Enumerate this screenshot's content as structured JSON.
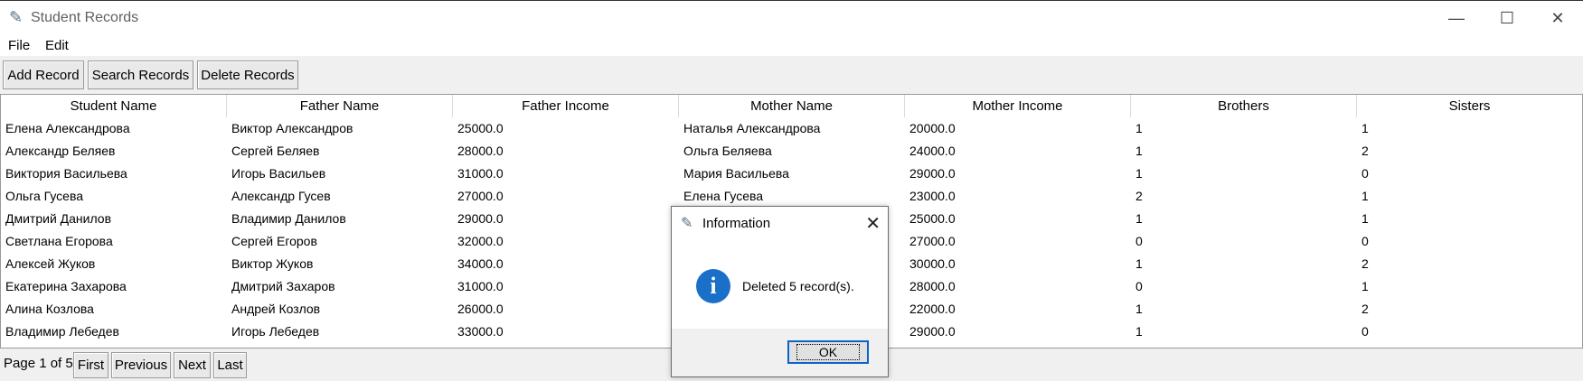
{
  "window": {
    "title": "Student Records",
    "controls": {
      "minimize": "—",
      "maximize": "☐",
      "close": "✕"
    }
  },
  "menu": [
    "File",
    "Edit"
  ],
  "toolbar": {
    "add": "Add Record",
    "search": "Search Records",
    "delete": "Delete Records"
  },
  "table": {
    "columns": [
      "Student Name",
      "Father Name",
      "Father Income",
      "Mother Name",
      "Mother Income",
      "Brothers",
      "Sisters"
    ],
    "rows": [
      [
        "Елена Александрова",
        "Виктор Александров",
        "25000.0",
        "Наталья Александрова",
        "20000.0",
        "1",
        "1"
      ],
      [
        "Александр Беляев",
        "Сергей Беляев",
        "28000.0",
        "Ольга Беляева",
        "24000.0",
        "1",
        "2"
      ],
      [
        "Виктория Васильева",
        "Игорь Васильев",
        "31000.0",
        "Мария Васильева",
        "29000.0",
        "1",
        "0"
      ],
      [
        "Ольга Гусева",
        "Александр Гусев",
        "27000.0",
        "Елена Гусева",
        "23000.0",
        "2",
        "1"
      ],
      [
        "Дмитрий Данилов",
        "Владимир Данилов",
        "29000.0",
        "",
        "25000.0",
        "1",
        "1"
      ],
      [
        "Светлана Егорова",
        "Сергей Егоров",
        "32000.0",
        "",
        "27000.0",
        "0",
        "0"
      ],
      [
        "Алексей Жуков",
        "Виктор Жуков",
        "34000.0",
        "",
        "30000.0",
        "1",
        "2"
      ],
      [
        "Екатерина Захарова",
        "Дмитрий Захаров",
        "31000.0",
        "",
        "28000.0",
        "0",
        "1"
      ],
      [
        "Алина Козлова",
        "Андрей Козлов",
        "26000.0",
        "",
        "22000.0",
        "1",
        "2"
      ],
      [
        "Владимир Лебедев",
        "Игорь Лебедев",
        "33000.0",
        "",
        "29000.0",
        "1",
        "0"
      ]
    ]
  },
  "pager": {
    "info": "Page 1 of 5",
    "first": "First",
    "previous": "Previous",
    "next": "Next",
    "last": "Last"
  },
  "dialog": {
    "title": "Information",
    "message": "Deleted 5 record(s).",
    "ok": "OK",
    "close": "✕",
    "info_glyph": "i"
  },
  "colors": {
    "accent": "#1a6fc9",
    "dialog_border": "#0a64c8"
  }
}
